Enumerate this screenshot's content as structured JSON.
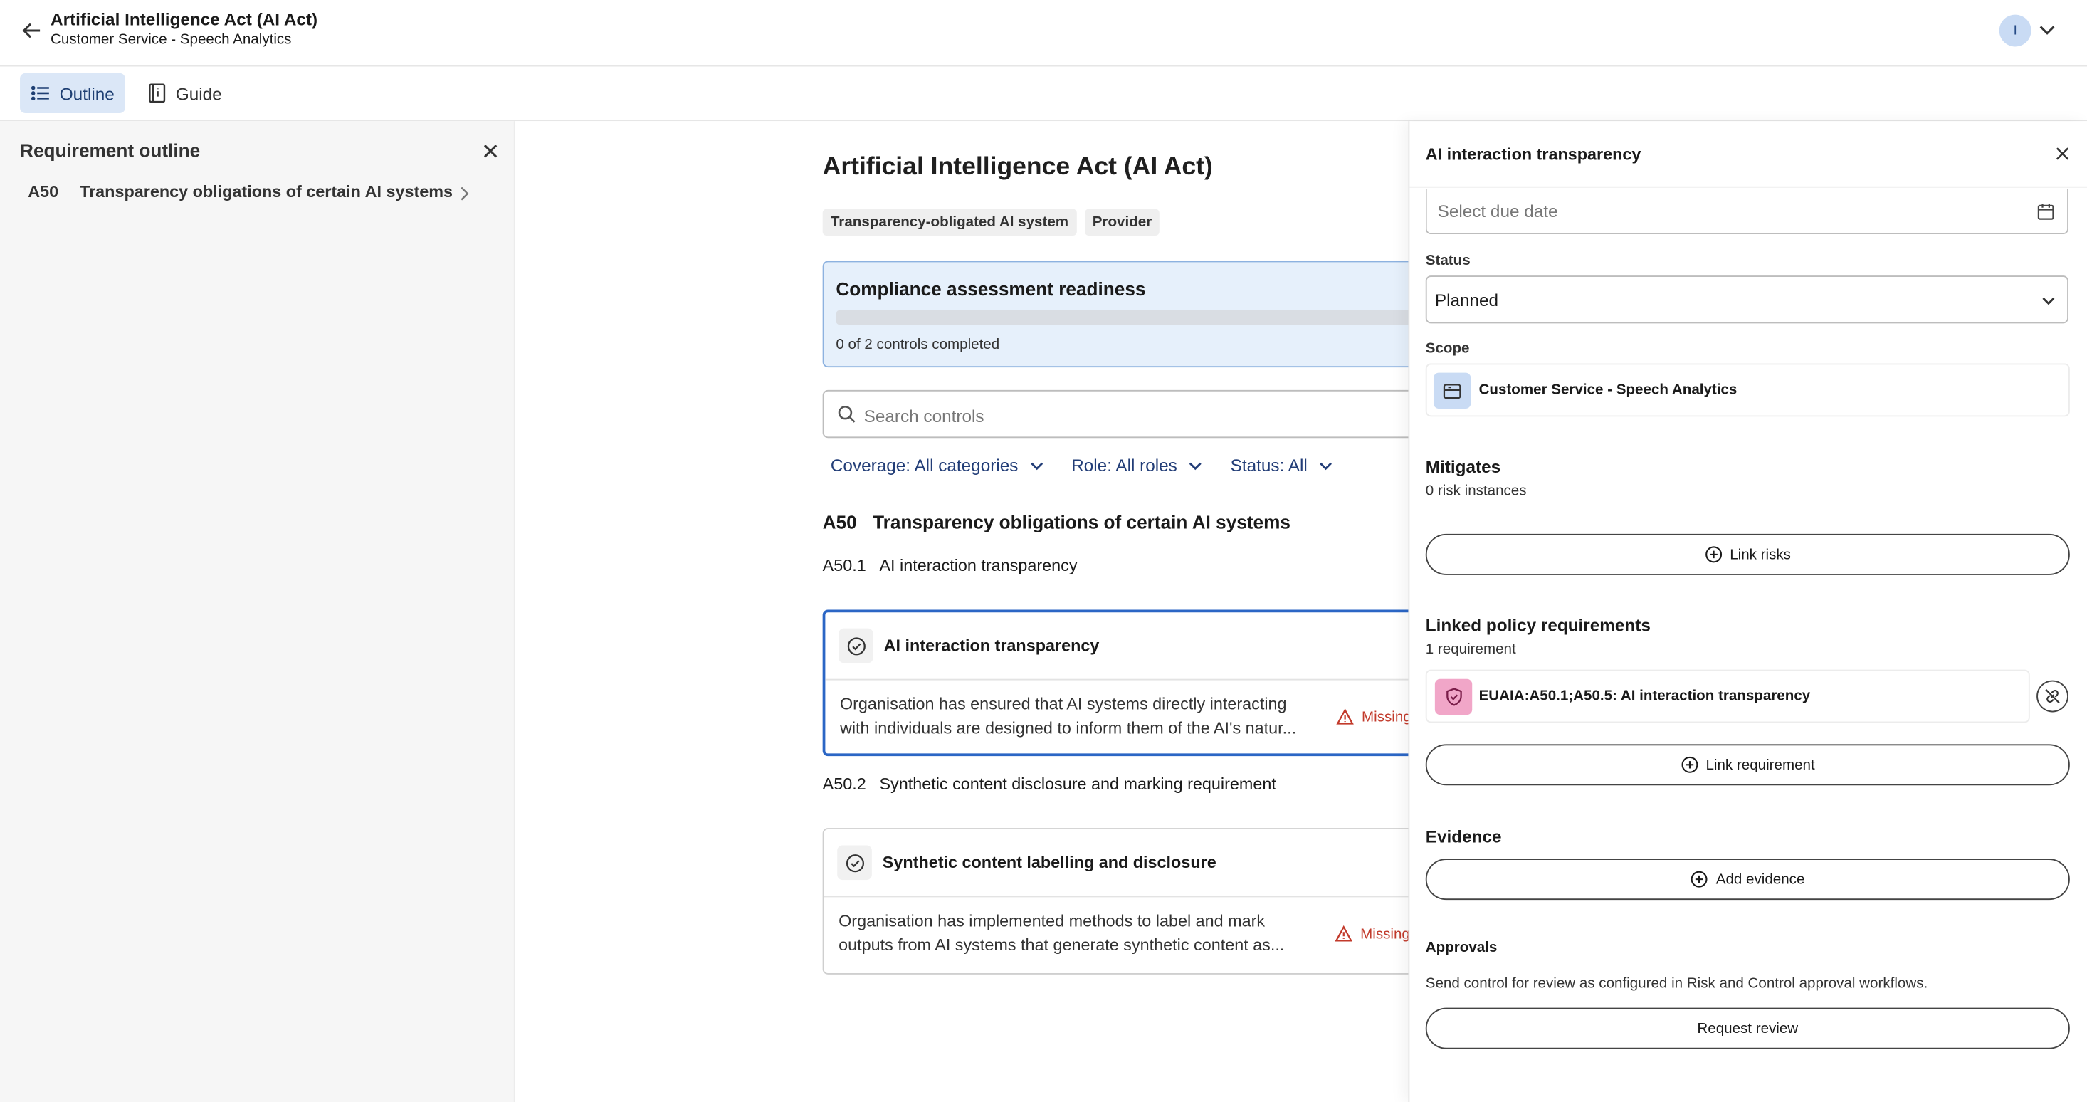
{
  "header": {
    "title": "Artificial Intelligence Act (AI Act)",
    "subtitle": "Customer Service - Speech Analytics",
    "avatar_initial": "I"
  },
  "toolbar": {
    "outline_label": "Outline",
    "guide_label": "Guide"
  },
  "left_panel": {
    "title": "Requirement outline",
    "items": [
      {
        "code": "A50",
        "label": "Transparency obligations of certain AI systems"
      }
    ]
  },
  "main": {
    "title": "Artificial Intelligence Act (AI Act)",
    "tags": [
      "Transparency-obligated AI system",
      "Provider"
    ],
    "readiness": {
      "title": "Compliance assessment readiness",
      "progress": 0,
      "summary": "0 of 2 controls completed"
    },
    "search": {
      "placeholder": "Search controls"
    },
    "filters": {
      "coverage": "Coverage: All categories",
      "role": "Role: All roles",
      "status": "Status: All"
    },
    "section": {
      "code": "A50",
      "title": "Transparency obligations of certain AI systems",
      "subsections": [
        {
          "code": "A50.1",
          "title": "AI interaction transparency",
          "control": {
            "title": "AI interaction transparency",
            "description": "Organisation has ensured that AI systems directly interacting with individuals are designed to inform them of the AI's natur...",
            "status": "Missing"
          }
        },
        {
          "code": "A50.2",
          "title": "Synthetic content disclosure and marking requirement",
          "control": {
            "title": "Synthetic content labelling and disclosure",
            "description": "Organisation has implemented methods to label and mark outputs from AI systems that generate synthetic content as...",
            "status": "Missing"
          }
        }
      ]
    }
  },
  "detail": {
    "title": "AI interaction transparency",
    "due_date_placeholder": "Select due date",
    "status_label": "Status",
    "status_value": "Planned",
    "scope_label": "Scope",
    "scope_value": "Customer Service - Speech Analytics",
    "mitigates_title": "Mitigates",
    "mitigates_count": "0 risk instances",
    "link_risks": "Link risks",
    "policy_title": "Linked policy requirements",
    "policy_count": "1 requirement",
    "policy_item": "EUAIA:A50.1;A50.5: AI interaction transparency",
    "link_requirement": "Link requirement",
    "evidence_title": "Evidence",
    "add_evidence": "Add evidence",
    "approvals_title": "Approvals",
    "approvals_text": "Send control for review as configured in Risk and Control approval workflows.",
    "request_review": "Request review"
  },
  "colors": {
    "accent": "#2b66c5",
    "readiness_bg": "#e6f0fb",
    "missing": "#c23a2b",
    "scope_icon_bg": "#c9dbf4",
    "policy_icon_bg": "#f1a6c8"
  }
}
